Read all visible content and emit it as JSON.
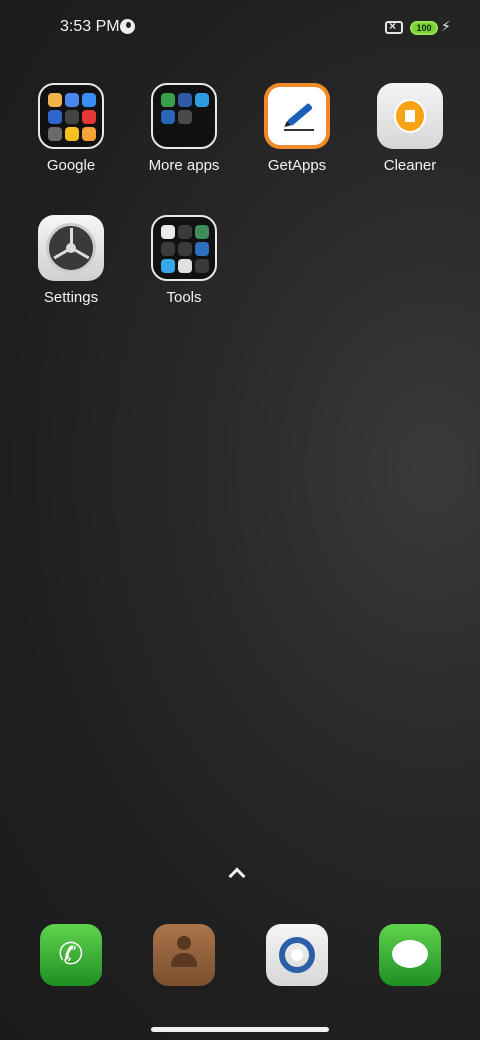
{
  "status_bar": {
    "time": "3:53 PM",
    "battery_level": "100",
    "sim_indicator": "×",
    "charging_icon": "bolt-icon"
  },
  "apps": [
    {
      "label": "Google",
      "type": "folder",
      "icon": "google-folder-icon"
    },
    {
      "label": "More apps",
      "type": "folder",
      "icon": "more-apps-folder-icon"
    },
    {
      "label": "GetApps",
      "type": "app",
      "icon": "getapps-icon"
    },
    {
      "label": "Cleaner",
      "type": "app",
      "icon": "cleaner-icon"
    },
    {
      "label": "Settings",
      "type": "app",
      "icon": "settings-icon"
    },
    {
      "label": "Tools",
      "type": "folder",
      "icon": "tools-folder-icon"
    }
  ],
  "folders": {
    "google": [
      "#f2b34a",
      "#4a86f0",
      "#3a8ef7",
      "#2f66c9",
      "#444",
      "#e53935",
      "#6a6a6a",
      "#f6c021",
      "#f8a43a"
    ],
    "more_apps": [
      "#37a24b",
      "#2f5aa8",
      "#2f9be0",
      "#2a67b8",
      "#4a4a4a",
      "#111",
      "#111",
      "#111",
      "#111"
    ],
    "tools": [
      "#e9e9e9",
      "#3a3a3a",
      "#3c8f5a",
      "#3a3a3a",
      "#3a3a3a",
      "#2e6fbf",
      "#35a7e6",
      "#e0e0e0",
      "#3a3a3a"
    ]
  },
  "dock": [
    {
      "name": "phone",
      "icon": "phone-icon"
    },
    {
      "name": "contacts",
      "icon": "contacts-icon"
    },
    {
      "name": "chrome",
      "icon": "chrome-icon"
    },
    {
      "name": "messages",
      "icon": "messages-icon"
    }
  ],
  "colors": {
    "battery": "#7bd23a",
    "getapps_accent": "#f08a28",
    "cleaner_accent": "#f6a316",
    "dock_green": "#1f8f25"
  }
}
